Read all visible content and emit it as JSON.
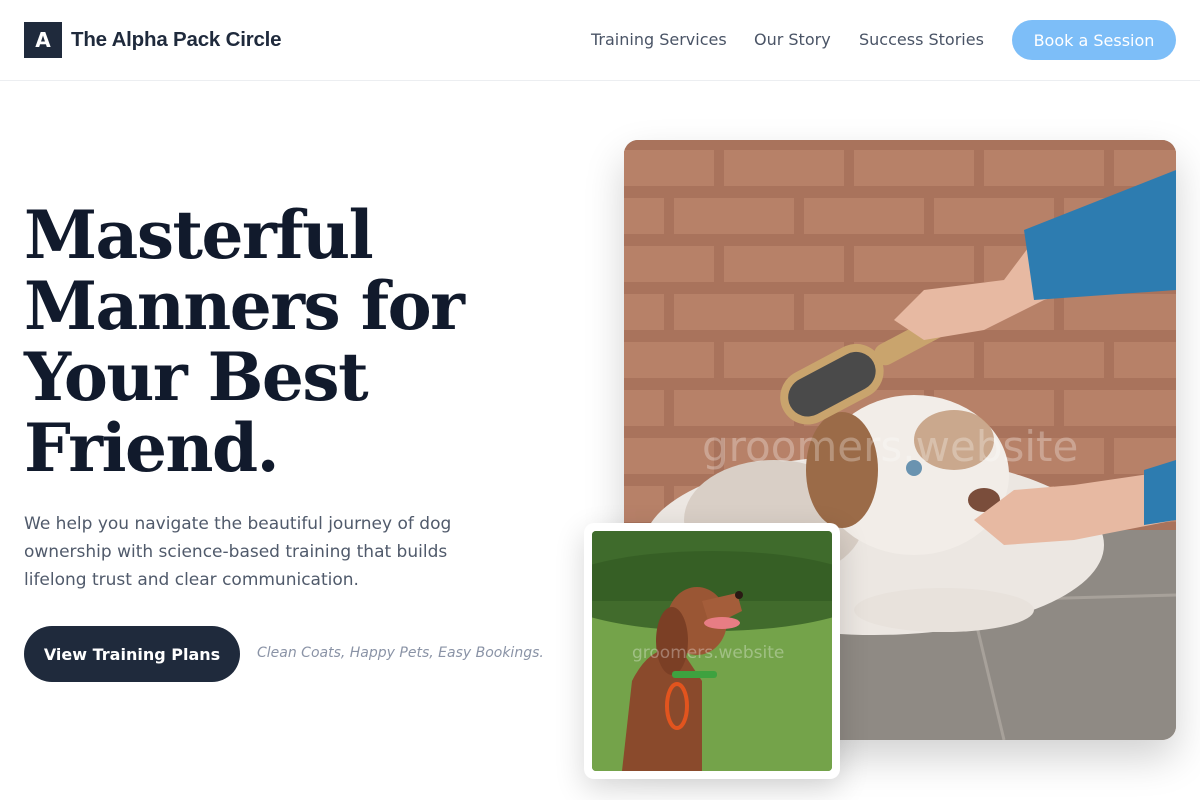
{
  "header": {
    "logo_letter": "A",
    "brand": "The Alpha Pack Circle",
    "nav": [
      "Training Services",
      "Our Story",
      "Success Stories"
    ],
    "cta_label": "Book a Session"
  },
  "hero": {
    "title_lines": [
      "Masterful",
      "Manners for",
      "Your Best",
      "Friend."
    ],
    "subtitle": "We help you navigate the beautiful journey of dog ownership with science-based training that builds lifelong trust and clear communication.",
    "primary_button": "View Training Plans",
    "tagline": "Clean Coats, Happy Pets, Easy Bookings."
  },
  "images": {
    "main_watermark": "groomers.website",
    "card_watermark": "groomers.website"
  },
  "colors": {
    "accent": "#7dbef8",
    "dark": "#1f2a3c"
  }
}
